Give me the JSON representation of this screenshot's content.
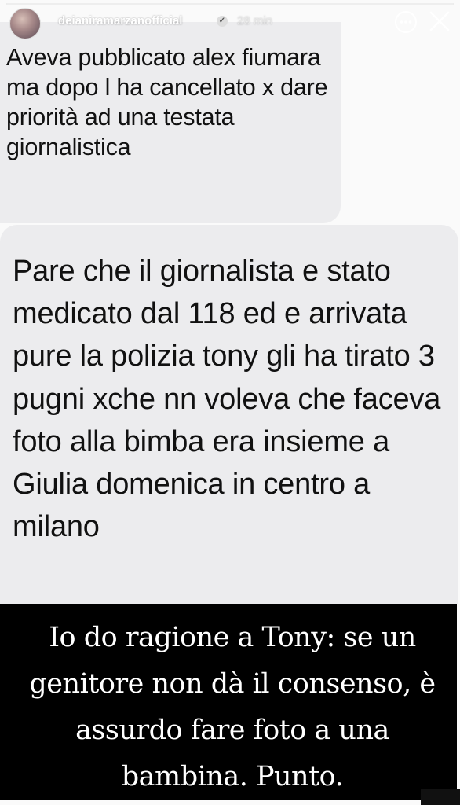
{
  "header": {
    "username": "deianiramarzanofficial",
    "verified_glyph": "✓",
    "time": "28 min",
    "more_icon": "more-dots-icon",
    "close_icon": "close-icon"
  },
  "messages": [
    {
      "text": "Aveva pubblicato alex fiumara ma dopo l ha cancellato x dare priorità ad una testata giornalistica"
    },
    {
      "text": "Pare che il giornalista e stato medicato dal 118 ed e arrivata pure la polizia tony gli ha tirato 3 pugni xche nn voleva che faceva foto alla bimba era insieme a Giulia domenica in centro a milano"
    }
  ],
  "caption": {
    "text": "Io do ragione a Tony: se un genitore non dà il consenso, è assurdo fare foto a una bambina. Punto."
  },
  "progress": 1.0,
  "colors": {
    "bubble": "#ececee",
    "caption_bg": "#000000",
    "caption_text": "#ffffff"
  }
}
